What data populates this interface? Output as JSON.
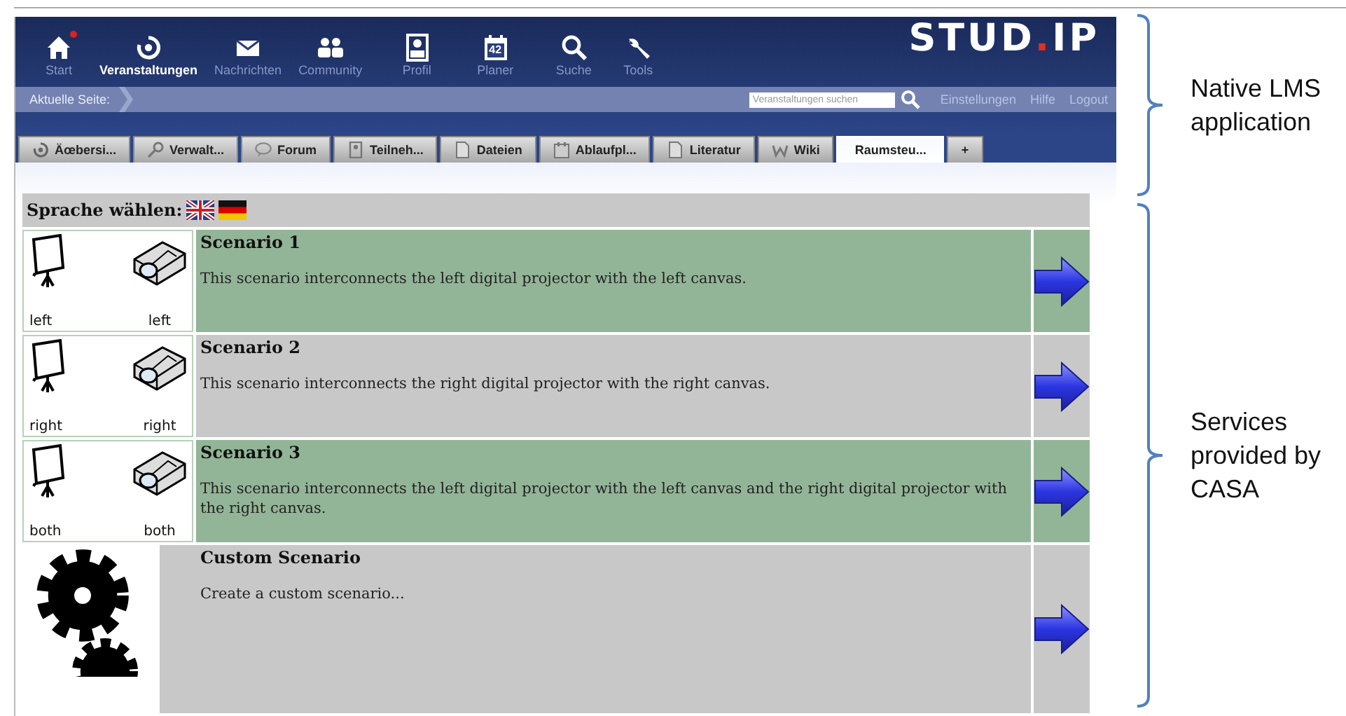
{
  "header": {
    "nav": [
      {
        "kind": "home",
        "label": "Start",
        "selected": false,
        "badge": true
      },
      {
        "kind": "courses",
        "label": "Veranstaltungen",
        "selected": true,
        "badge": false
      },
      {
        "kind": "mail",
        "label": "Nachrichten",
        "selected": false,
        "badge": false
      },
      {
        "kind": "community",
        "label": "Community",
        "selected": false,
        "badge": false
      },
      {
        "kind": "profile",
        "label": "Profil",
        "selected": false,
        "badge": false
      },
      {
        "kind": "calendar",
        "label": "Planer",
        "selected": false,
        "badge": false,
        "icon_text": "42"
      },
      {
        "kind": "search",
        "label": "Suche",
        "selected": false,
        "badge": false
      },
      {
        "kind": "tools",
        "label": "Tools",
        "selected": false,
        "badge": false
      }
    ],
    "logo": {
      "name": "STUD",
      "dot": ".",
      "suffix": "IP"
    }
  },
  "breadcrumb": {
    "label": "Aktuelle Seite:",
    "search": {
      "placeholder": "Veranstaltungen suchen"
    },
    "links": [
      "Einstellungen",
      "Hilfe",
      "Logout"
    ]
  },
  "tabs": [
    {
      "kind": "courses",
      "label": "Äœbersi...",
      "selected": false
    },
    {
      "kind": "key",
      "label": "Verwalt...",
      "selected": false
    },
    {
      "kind": "bubble",
      "label": "Forum",
      "selected": false
    },
    {
      "kind": "person",
      "label": "Teilneh...",
      "selected": false
    },
    {
      "kind": "file",
      "label": "Dateien",
      "selected": false
    },
    {
      "kind": "calendar",
      "label": "Ablaufpl...",
      "selected": false
    },
    {
      "kind": "file",
      "label": "Literatur",
      "selected": false
    },
    {
      "kind": "wiki",
      "label": "Wiki",
      "selected": false
    },
    {
      "kind": "none",
      "label": "Raumsteu...",
      "selected": true
    },
    {
      "kind": "none",
      "label": "+",
      "selected": false
    }
  ],
  "language": {
    "label": "Sprache wählen:",
    "flags": [
      {
        "kind": "uk"
      },
      {
        "kind": "de"
      }
    ]
  },
  "scenarios": [
    {
      "kind": "projector",
      "title": "Scenario 1",
      "description": "This scenario interconnects the left digital projector with the left canvas.",
      "color": "#93b597",
      "screen_label": "left",
      "projector_label": "left"
    },
    {
      "kind": "projector",
      "title": "Scenario 2",
      "description": "This scenario interconnects the right digital projector with the right canvas.",
      "color": "#c8c8c8",
      "screen_label": "right",
      "projector_label": "right"
    },
    {
      "kind": "projector",
      "title": "Scenario 3",
      "description": "This scenario interconnects the left digital projector with the left canvas and the right digital projector with the right canvas.",
      "color": "#93b597",
      "screen_label": "both",
      "projector_label": "both"
    },
    {
      "kind": "custom",
      "title": "Custom Scenario",
      "description": "Create a custom scenario...",
      "color": "#c8c8c8"
    }
  ],
  "annotations": [
    {
      "text": "Native LMS application"
    },
    {
      "text": "Services provided by CASA"
    }
  ]
}
